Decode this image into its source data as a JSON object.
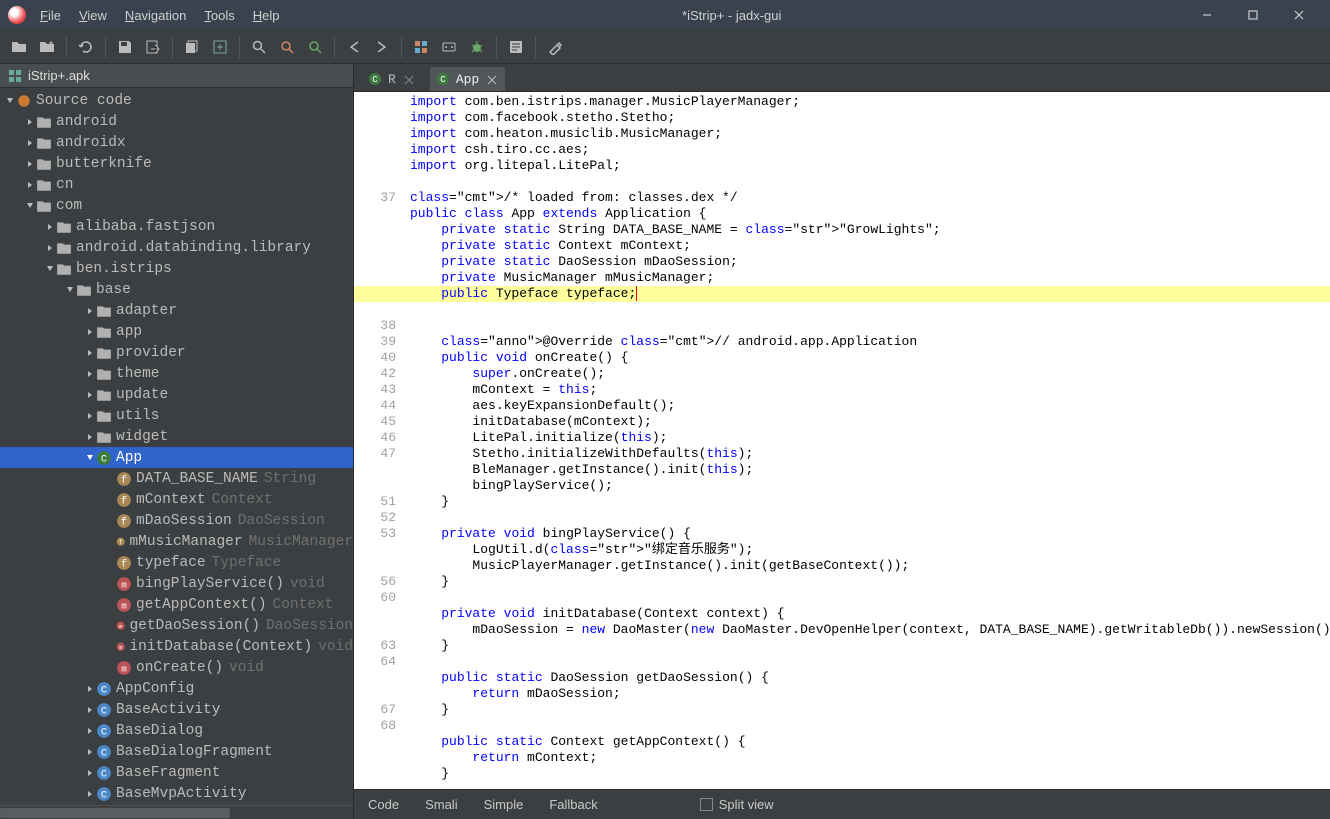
{
  "window": {
    "title": "*iStrip+ - jadx-gui"
  },
  "menu": {
    "file": "File",
    "view": "View",
    "navigation": "Navigation",
    "tools": "Tools",
    "help": "Help"
  },
  "tree": {
    "header": "iStrip+.apk",
    "root": "Source code",
    "nodes": {
      "android": "android",
      "androidx": "androidx",
      "butterknife": "butterknife",
      "cn": "cn",
      "com": "com",
      "alibaba": "alibaba.fastjson",
      "databinding": "android.databinding.library",
      "ben": "ben.istrips",
      "base": "base",
      "adapter": "adapter",
      "app": "app",
      "provider": "provider",
      "theme": "theme",
      "update": "update",
      "utils": "utils",
      "widget": "widget",
      "App": "App",
      "AppConfig": "AppConfig",
      "BaseActivity": "BaseActivity",
      "BaseDialog": "BaseDialog",
      "BaseDialogFragment": "BaseDialogFragment",
      "BaseFragment": "BaseFragment",
      "BaseMvpActivity": "BaseMvpActivity"
    },
    "members": {
      "DATA_BASE_NAME": {
        "name": "DATA_BASE_NAME",
        "type": "String"
      },
      "mContext": {
        "name": "mContext",
        "type": "Context"
      },
      "mDaoSession": {
        "name": "mDaoSession",
        "type": "DaoSession"
      },
      "mMusicManager": {
        "name": "mMusicManager",
        "type": "MusicManager"
      },
      "typeface": {
        "name": "typeface",
        "type": "Typeface"
      },
      "bingPlayService": {
        "name": "bingPlayService()",
        "type": "void"
      },
      "getAppContext": {
        "name": "getAppContext()",
        "type": "Context"
      },
      "getDaoSession": {
        "name": "getDaoSession()",
        "type": "DaoSession"
      },
      "initDatabase": {
        "name": "initDatabase(Context)",
        "type": "void"
      },
      "onCreate": {
        "name": "onCreate()",
        "type": "void"
      }
    }
  },
  "tabs": {
    "r": "R",
    "app": "App"
  },
  "gutter": [
    "",
    "",
    "",
    "",
    "",
    "",
    "37",
    "",
    "",
    "",
    "",
    "",
    "",
    "",
    "38",
    "39",
    "40",
    "42",
    "43",
    "44",
    "45",
    "46",
    "47",
    "",
    "",
    "51",
    "52",
    "53",
    "",
    "",
    "56",
    "60",
    "",
    "",
    "63",
    "64",
    "",
    "",
    "67",
    "68",
    "",
    ""
  ],
  "code": {
    "l1": "import com.ben.istrips.manager.MusicPlayerManager;",
    "l2": "import com.facebook.stetho.Stetho;",
    "l3": "import com.heaton.musiclib.MusicManager;",
    "l4": "import csh.tiro.cc.aes;",
    "l5": "import org.litepal.LitePal;",
    "l6": "",
    "l7": "/* loaded from: classes.dex */",
    "l8": "public class App extends Application {",
    "l9": "    private static String DATA_BASE_NAME = \"GrowLights\";",
    "l10": "    private static Context mContext;",
    "l11": "    private static DaoSession mDaoSession;",
    "l12": "    private MusicManager mMusicManager;",
    "l13": "    public Typeface typeface;",
    "l14": "",
    "l15": "    @Override // android.app.Application",
    "l16": "    public void onCreate() {",
    "l17": "        super.onCreate();",
    "l18": "        mContext = this;",
    "l19": "        aes.keyExpansionDefault();",
    "l20": "        initDatabase(mContext);",
    "l21": "        LitePal.initialize(this);",
    "l22": "        Stetho.initializeWithDefaults(this);",
    "l23": "        BleManager.getInstance().init(this);",
    "l24": "        bingPlayService();",
    "l25": "    }",
    "l26": "",
    "l27": "    private void bingPlayService() {",
    "l28": "        LogUtil.d(\"绑定音乐服务\");",
    "l29": "        MusicPlayerManager.getInstance().init(getBaseContext());",
    "l30": "    }",
    "l31": "",
    "l32": "    private void initDatabase(Context context) {",
    "l33": "        mDaoSession = new DaoMaster(new DaoMaster.DevOpenHelper(context, DATA_BASE_NAME).getWritableDb()).newSession();",
    "l34": "    }",
    "l35": "",
    "l36": "    public static DaoSession getDaoSession() {",
    "l37": "        return mDaoSession;",
    "l38": "    }",
    "l39": "",
    "l40": "    public static Context getAppContext() {",
    "l41": "        return mContext;",
    "l42": "    }"
  },
  "bottom": {
    "code": "Code",
    "smali": "Smali",
    "simple": "Simple",
    "fallback": "Fallback",
    "split": "Split view"
  }
}
